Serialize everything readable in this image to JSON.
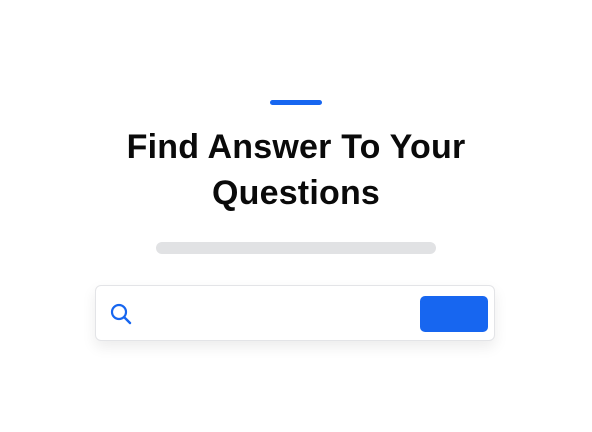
{
  "hero": {
    "title_line1": "Find Answer To Your",
    "title_line2": "Questions"
  },
  "search": {
    "value": "",
    "placeholder": "",
    "button_label": ""
  },
  "icons": {
    "search": "search-icon"
  },
  "colors": {
    "accent": "#1766f0",
    "title": "#0a0a0a",
    "placeholder_bar": "#e1e2e4",
    "card_border": "#e3e4e7"
  }
}
